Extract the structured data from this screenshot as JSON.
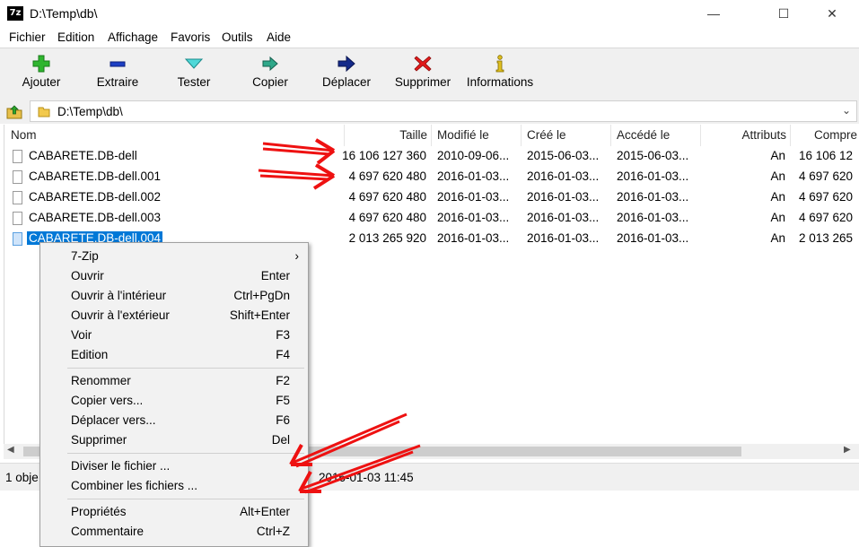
{
  "window": {
    "app_icon_text": "7z",
    "title": "D:\\Temp\\db\\",
    "minimize_glyph": "—",
    "maximize_glyph": "☐",
    "close_glyph": "✕"
  },
  "menubar": [
    "Fichier",
    "Edition",
    "Affichage",
    "Favoris",
    "Outils",
    "Aide"
  ],
  "toolbar": [
    {
      "label": "Ajouter",
      "icon": "add-icon"
    },
    {
      "label": "Extraire",
      "icon": "extract-icon"
    },
    {
      "label": "Tester",
      "icon": "test-icon"
    },
    {
      "label": "Copier",
      "icon": "copy-icon"
    },
    {
      "label": "Déplacer",
      "icon": "move-icon"
    },
    {
      "label": "Supprimer",
      "icon": "delete-icon"
    },
    {
      "label": "Informations",
      "icon": "info-icon"
    }
  ],
  "address": {
    "path": "D:\\Temp\\db\\",
    "chevron": "⌄"
  },
  "columns": [
    "Nom",
    "Taille",
    "Modifié le",
    "Créé le",
    "Accédé le",
    "Attributs",
    "Compre"
  ],
  "files": [
    {
      "name": "CABARETE.DB-dell",
      "size": "16 106 127 360",
      "modified": "2010-09-06...",
      "created": "2015-06-03...",
      "accessed": "2015-06-03...",
      "attributes": "An",
      "compressed": "16 106 12",
      "selected": false
    },
    {
      "name": "CABARETE.DB-dell.001",
      "size": "4 697 620 480",
      "modified": "2016-01-03...",
      "created": "2016-01-03...",
      "accessed": "2016-01-03...",
      "attributes": "An",
      "compressed": "4 697 620",
      "selected": false
    },
    {
      "name": "CABARETE.DB-dell.002",
      "size": "4 697 620 480",
      "modified": "2016-01-03...",
      "created": "2016-01-03...",
      "accessed": "2016-01-03...",
      "attributes": "An",
      "compressed": "4 697 620",
      "selected": false
    },
    {
      "name": "CABARETE.DB-dell.003",
      "size": "4 697 620 480",
      "modified": "2016-01-03...",
      "created": "2016-01-03...",
      "accessed": "2016-01-03...",
      "attributes": "An",
      "compressed": "4 697 620",
      "selected": false
    },
    {
      "name": "CABARETE.DB-dell.004",
      "size": "2 013 265 920",
      "modified": "2016-01-03...",
      "created": "2016-01-03...",
      "accessed": "2016-01-03...",
      "attributes": "An",
      "compressed": "2 013 265",
      "selected": true
    }
  ],
  "scrollbar": {
    "left_arrow": "◀",
    "right_arrow": "▶"
  },
  "status": {
    "left": "1 obje",
    "date": "2016-01-03 11:45"
  },
  "context_menu": [
    {
      "label": "7-Zip",
      "shortcut": "›",
      "group": 0
    },
    {
      "label": "Ouvrir",
      "shortcut": "Enter",
      "group": 0
    },
    {
      "label": "Ouvrir à l'intérieur",
      "shortcut": "Ctrl+PgDn",
      "group": 0
    },
    {
      "label": "Ouvrir à l'extérieur",
      "shortcut": "Shift+Enter",
      "group": 0
    },
    {
      "label": "Voir",
      "shortcut": "F3",
      "group": 0
    },
    {
      "label": "Edition",
      "shortcut": "F4",
      "group": 0
    },
    {
      "label": "Renommer",
      "shortcut": "F2",
      "group": 1
    },
    {
      "label": "Copier vers...",
      "shortcut": "F5",
      "group": 1
    },
    {
      "label": "Déplacer vers...",
      "shortcut": "F6",
      "group": 1
    },
    {
      "label": "Supprimer",
      "shortcut": "Del",
      "group": 1
    },
    {
      "label": "Diviser le fichier ...",
      "shortcut": "",
      "group": 2
    },
    {
      "label": "Combiner les fichiers ...",
      "shortcut": "",
      "group": 2
    },
    {
      "label": "Propriétés",
      "shortcut": "Alt+Enter",
      "group": 3
    },
    {
      "label": "Commentaire",
      "shortcut": "Ctrl+Z",
      "group": 3
    }
  ],
  "colors": {
    "selection": "#0078d7",
    "annotation_arrow": "#ee1111",
    "toolbar_bg": "#f0f0f0"
  }
}
